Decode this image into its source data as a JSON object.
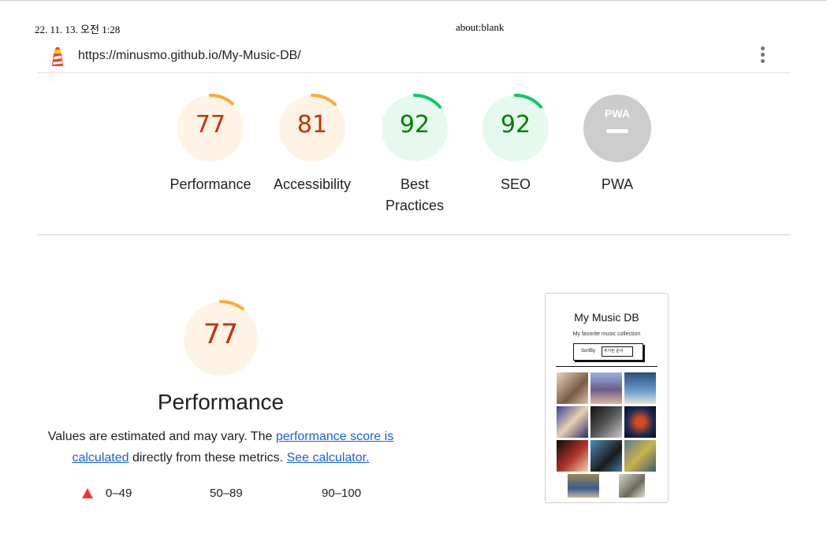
{
  "print_header": {
    "date": "22. 11. 13. 오전 1:28",
    "page": "about:blank"
  },
  "url": "https://minusmo.github.io/My-Music-DB/",
  "icons": {
    "logo": "lighthouse-icon",
    "menu": "kebab-menu-icon"
  },
  "colors": {
    "average": "#fa3",
    "average_text": "#c33300",
    "pass": "#0c6",
    "pass_text": "#008000",
    "pwa_gray": "#cccccc",
    "link": "#1a5fe6",
    "fail": "#ff3333"
  },
  "categories": [
    {
      "label": "Performance",
      "score": "77",
      "value": 0.77,
      "rating": "average"
    },
    {
      "label": "Accessibility",
      "score": "81",
      "value": 0.81,
      "rating": "average"
    },
    {
      "label": "Best Practices",
      "score": "92",
      "value": 0.92,
      "rating": "pass"
    },
    {
      "label": "SEO",
      "score": "92",
      "value": 0.92,
      "rating": "pass"
    },
    {
      "label": "PWA",
      "score": "",
      "badge": "PWA",
      "rating": "na"
    }
  ],
  "performance": {
    "score": "77",
    "value": 0.77,
    "title": "Performance",
    "desc_1": "Values are estimated and may vary. The ",
    "link_1": "performance score is calculated",
    "desc_2": " directly from these metrics. ",
    "link_2": "See calculator.",
    "legend": [
      "0–49",
      "50–89",
      "90–100"
    ]
  },
  "screenshot": {
    "title": "My Music DB",
    "subtitle": "My favorite music collection",
    "sort_label": "SortBy",
    "sort_value": "추가된 순서"
  }
}
